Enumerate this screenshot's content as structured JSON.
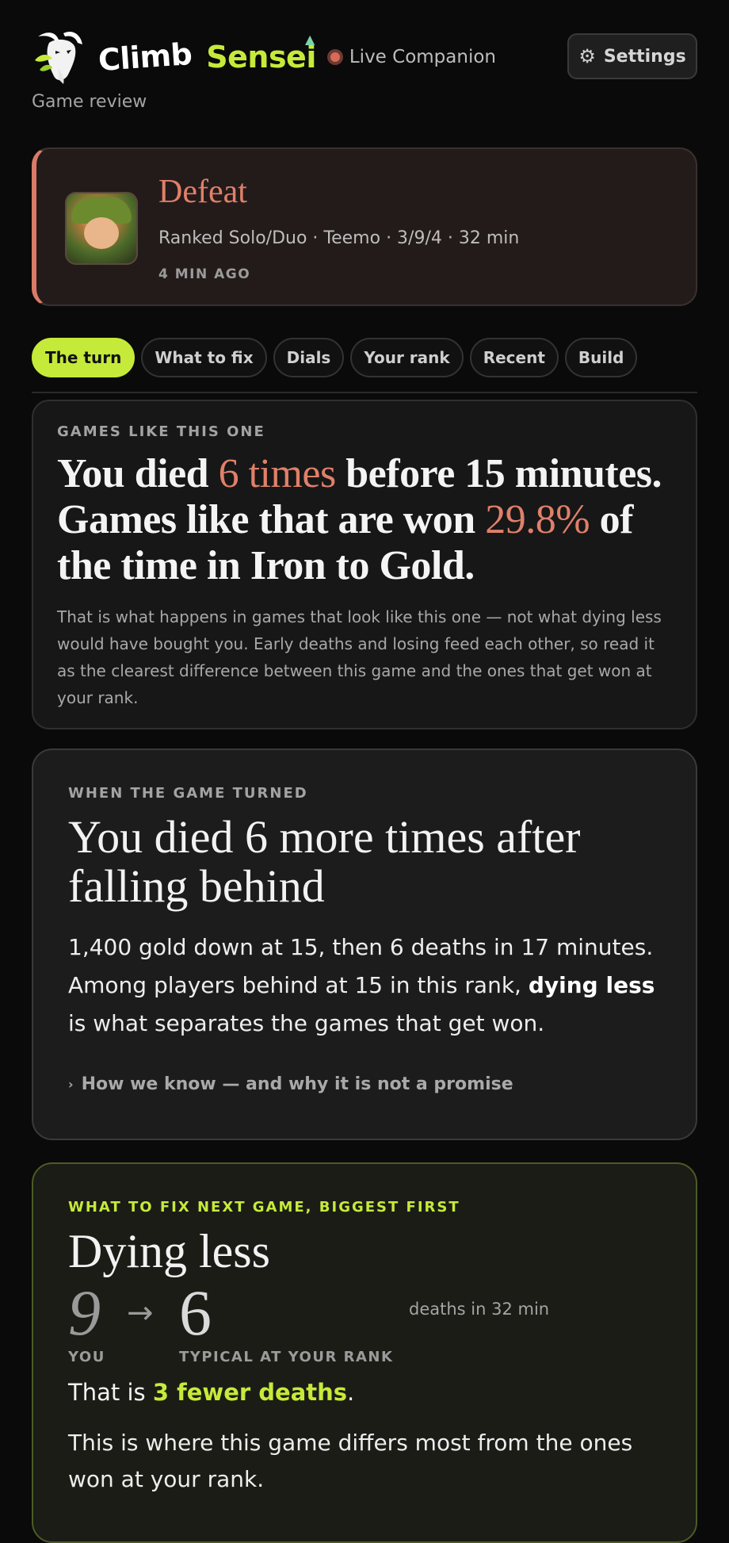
{
  "header": {
    "brand_part1": "Climb",
    "brand_part2": "Sensei",
    "live_label": "Live Companion",
    "subtitle": "Game review",
    "settings_label": "Settings"
  },
  "result": {
    "title": "Defeat",
    "meta": "Ranked Solo/Duo · Teemo · 3/9/4 · 32 min",
    "time_ago": "4 MIN AGO",
    "champion_icon": "teemo-portrait"
  },
  "tabs": [
    {
      "label": "The turn",
      "active": true
    },
    {
      "label": "What to fix",
      "active": false
    },
    {
      "label": "Dials",
      "active": false
    },
    {
      "label": "Your rank",
      "active": false
    },
    {
      "label": "Recent",
      "active": false
    },
    {
      "label": "Build",
      "active": false
    }
  ],
  "games_like": {
    "eyebrow": "GAMES LIKE THIS ONE",
    "head_a": "You died ",
    "head_hl1": "6 times",
    "head_b": " before 15 minutes. Games like that are won ",
    "head_hl2": "29.8%",
    "head_c": " of the time in Iron to Gold.",
    "body": "That is what happens in games that look like this one — not what dying less would have bought you. Early deaths and losing feed each other, so read it as the clearest difference between this game and the ones that get won at your rank."
  },
  "turn": {
    "eyebrow": "WHEN THE GAME TURNED",
    "head": "You died 6 more times after falling behind",
    "body_a": "1,400 gold down at 15, then 6 deaths in 17 minutes. Among players behind at 15 in this rank, ",
    "body_bold": "dying less",
    "body_b": " is what separates the games that get won.",
    "how_link": "How we know — and why it is not a promise"
  },
  "fix": {
    "eyebrow": "WHAT TO FIX NEXT GAME, BIGGEST FIRST",
    "head": "Dying less",
    "you_value": "9",
    "arrow": "→",
    "typical_value": "6",
    "unit": "deaths in 32 min",
    "you_label": "YOU",
    "typical_label": "TYPICAL AT YOUR RANK",
    "fewer_a": "That is ",
    "fewer_hl": "3 fewer deaths",
    "fewer_b": ".",
    "body": "This is where this game differs most from the ones won at your rank."
  },
  "colors": {
    "accent": "#c6ea3a",
    "defeat": "#e0806a",
    "background": "#0a0a0a"
  }
}
